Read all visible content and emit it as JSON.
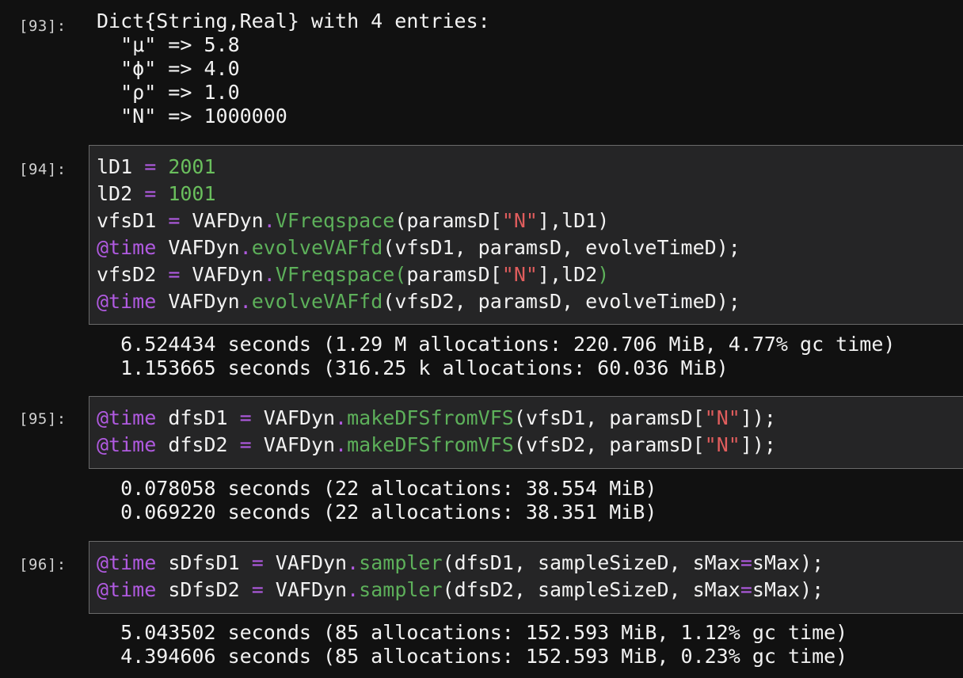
{
  "cells": [
    {
      "prompt": "[93]:",
      "output": [
        "Dict{String,Real} with 4 entries:",
        "  \"μ\" => 5.8",
        "  \"ϕ\" => 4.0",
        "  \"ρ\" => 1.0",
        "  \"N\" => 1000000"
      ]
    },
    {
      "prompt": "[94]:",
      "code_tokens": [
        [
          "lD1",
          " = ",
          "2001"
        ],
        [
          "lD2",
          " = ",
          "1001"
        ],
        [
          "vfsD1",
          " = ",
          "VAFDyn",
          ".",
          "VFreqspace",
          "(paramsD[",
          "\"N\"",
          "],lD1)"
        ],
        [
          "@time",
          " VAFDyn",
          ".",
          "evolveVAFfd",
          "(vfsD1, paramsD, evolveTimeD);"
        ],
        [
          "vfsD2",
          " = ",
          "VAFDyn",
          ".",
          "VFreqspace(",
          "paramsD[",
          "\"N\"",
          "],lD2",
          ")"
        ],
        [
          "@time",
          " VAFDyn",
          ".",
          "evolveVAFfd",
          "(vfsD2, paramsD, evolveTimeD);"
        ]
      ],
      "output": [
        "  6.524434 seconds (1.29 M allocations: 220.706 MiB, 4.77% gc time)",
        "  1.153665 seconds (316.25 k allocations: 60.036 MiB)"
      ]
    },
    {
      "prompt": "[95]:",
      "code_tokens": [
        [
          "@time",
          " dfsD1 ",
          "=",
          " VAFDyn",
          ".",
          "makeDFSfromVFS",
          "(vfsD1, paramsD[",
          "\"N\"",
          "]);"
        ],
        [
          "@time",
          " dfsD2 ",
          "=",
          " VAFDyn",
          ".",
          "makeDFSfromVFS",
          "(vfsD2, paramsD[",
          "\"N\"",
          "]);"
        ]
      ],
      "output": [
        "  0.078058 seconds (22 allocations: 38.554 MiB)",
        "  0.069220 seconds (22 allocations: 38.351 MiB)"
      ]
    },
    {
      "prompt": "[96]:",
      "code_tokens": [
        [
          "@time",
          " sDfsD1 ",
          "=",
          " VAFDyn",
          ".",
          "sampler",
          "(dfsD1, sampleSizeD, sMax",
          "=",
          "sMax);"
        ],
        [
          "@time",
          " sDfsD2 ",
          "=",
          " VAFDyn",
          ".",
          "sampler",
          "(dfsD2, sampleSizeD, sMax",
          "=",
          "sMax);"
        ]
      ],
      "output": [
        "  5.043502 seconds (85 allocations: 152.593 MiB, 1.12% gc time)",
        "  4.394606 seconds (85 allocations: 152.593 MiB, 0.23% gc time)"
      ]
    }
  ],
  "colors": {
    "background": "#111111",
    "cell_background": "#252526",
    "keyword": "#b05ae0",
    "number": "#6abf5d",
    "function": "#5db05a",
    "string": "#e05d5d"
  }
}
